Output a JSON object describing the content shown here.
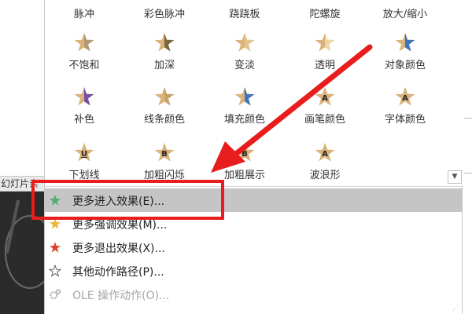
{
  "background": {
    "slide_panel_label": "幻灯片",
    "slide_panel_truncated": "亲"
  },
  "gallery": {
    "top_row": [
      "脉冲",
      "彩色脉冲",
      "跷跷板",
      "陀螺旋",
      "放大/缩小"
    ],
    "rows": [
      [
        {
          "label": "不饱和",
          "icon": "star-desaturate-icon",
          "color": "#b39a72"
        },
        {
          "label": "加深",
          "icon": "star-darken-icon",
          "color": "#7e6640"
        },
        {
          "label": "变淡",
          "icon": "star-lighten-icon",
          "color": "#e3c48a"
        },
        {
          "label": "透明",
          "icon": "star-transparency-icon",
          "color": "#ecd6a8"
        },
        {
          "label": "对象颜色",
          "icon": "star-object-color-icon",
          "color": "#3e74b8"
        }
      ],
      [
        {
          "label": "补色",
          "icon": "star-complementary-color-icon",
          "color": "#7a4fa3"
        },
        {
          "label": "线条颜色",
          "icon": "star-line-color-icon",
          "color": "#c8a06a"
        },
        {
          "label": "填充颜色",
          "icon": "star-fill-color-icon",
          "color": "#3e74b8"
        },
        {
          "label": "画笔颜色",
          "icon": "star-brush-color-icon",
          "color": "#d9b078",
          "letter": "A"
        },
        {
          "label": "字体颜色",
          "icon": "star-font-color-icon",
          "color": "#d9b078",
          "letter": "A"
        }
      ],
      [
        {
          "label": "下划线",
          "icon": "star-underline-icon",
          "color": "#d9b078",
          "letter": "U"
        },
        {
          "label": "加粗闪烁",
          "icon": "star-bold-flash-icon",
          "color": "#d9b078",
          "letter": "B"
        },
        {
          "label": "加粗展示",
          "icon": "star-bold-reveal-icon",
          "color": "#d9b078",
          "letter": "B"
        },
        {
          "label": "波浪形",
          "icon": "star-wave-icon",
          "color": "#d9b078",
          "letter": "A"
        }
      ]
    ],
    "more_button_icon": "dropdown-arrow-icon"
  },
  "menu": [
    {
      "label": "更多进入效果(E)...",
      "icon": "green-star-icon",
      "color": "#4caf6e",
      "highlight": true
    },
    {
      "label": "更多强调效果(M)...",
      "icon": "gold-star-icon",
      "color": "#f0b63c"
    },
    {
      "label": "更多退出效果(X)...",
      "icon": "red-star-icon",
      "color": "#d9452b"
    },
    {
      "label": "其他动作路径(P)...",
      "icon": "outline-star-icon",
      "color": "#555555"
    },
    {
      "label": "OLE 操作动作(O)...",
      "icon": "gears-icon",
      "color": "#b0b0b0",
      "disabled": true
    }
  ],
  "annotation": {
    "color": "#e81d1d"
  }
}
